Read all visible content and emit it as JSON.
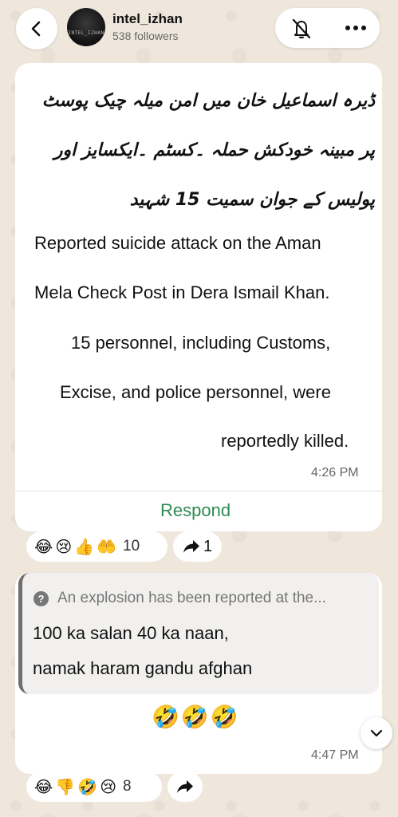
{
  "header": {
    "channel_name": "intel_izhan",
    "followers": "538 followers",
    "avatar_text": "INTEL_IZHAN",
    "back_icon": "chevron-left-icon",
    "mute_icon": "bell-off-icon",
    "more_icon": "more-horizontal-icon"
  },
  "message1": {
    "urdu_text": "ڈیرہ اسماعیل خان میں امن میلہ چیک پوسٹ پر مبینہ خودکش حملہ ۔کسٹم ۔ایکسایز اور پولیس کے جوان سمیت 15 شہید",
    "english_lines": [
      "Reported suicide attack on the Aman",
      "Mela Check Post in Dera Ismail Khan.",
      "15 personnel, including Customs,",
      "Excise, and police personnel, were",
      "reportedly killed."
    ],
    "time": "4:26 PM",
    "respond_label": "Respond",
    "reactions": [
      "😂",
      "😢",
      "👍",
      "🤲"
    ],
    "reaction_count": "10",
    "forward_count": "1"
  },
  "message2": {
    "quote_icon": "question-circle-icon",
    "quote_text": "An explosion has been reported at the...",
    "lines": [
      "100 ka salan 40 ka naan,",
      "namak haram gandu  afghan"
    ],
    "emoji_line": "🤣🤣🤣",
    "time": "4:47 PM",
    "reactions": [
      "😂",
      "👎",
      "🤣",
      "😢"
    ],
    "reaction_count": "8"
  },
  "colors": {
    "background": "#efe7dc",
    "bubble": "#ffffff",
    "accent_green": "#2f8a55",
    "muted_text": "#666666"
  }
}
